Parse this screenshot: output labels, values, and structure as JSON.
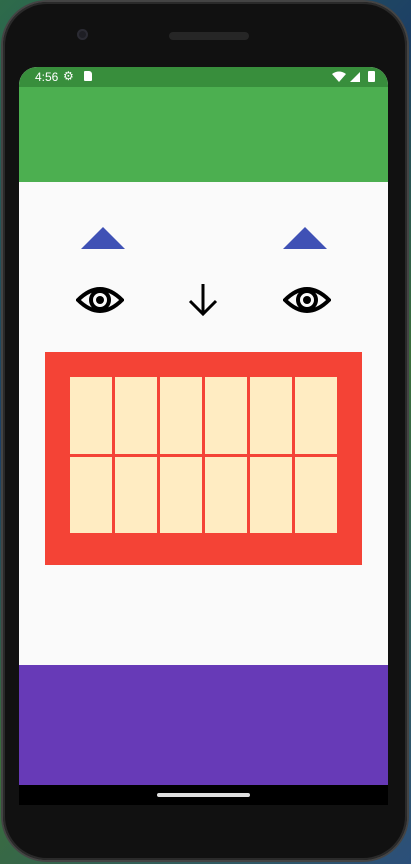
{
  "status_bar": {
    "time": "4:56",
    "color": "#388e3c",
    "left_icons": [
      "settings-icon",
      "sd-card-icon"
    ],
    "right_icons": [
      "wifi-icon",
      "signal-icon",
      "battery-icon"
    ]
  },
  "app_bar": {
    "color": "#4caf50"
  },
  "face": {
    "eyebrow_color": "#3f51b5",
    "eye_icon": "eye-icon",
    "nose_icon": "arrow-down-icon",
    "mouth_color": "#f44336",
    "teeth_color": "#ffecc2",
    "teeth_rows": 2,
    "teeth_per_row": 6
  },
  "bottom_bar": {
    "color": "#673ab7"
  },
  "navigation": {
    "home_indicator": "home-gesture-pill"
  }
}
